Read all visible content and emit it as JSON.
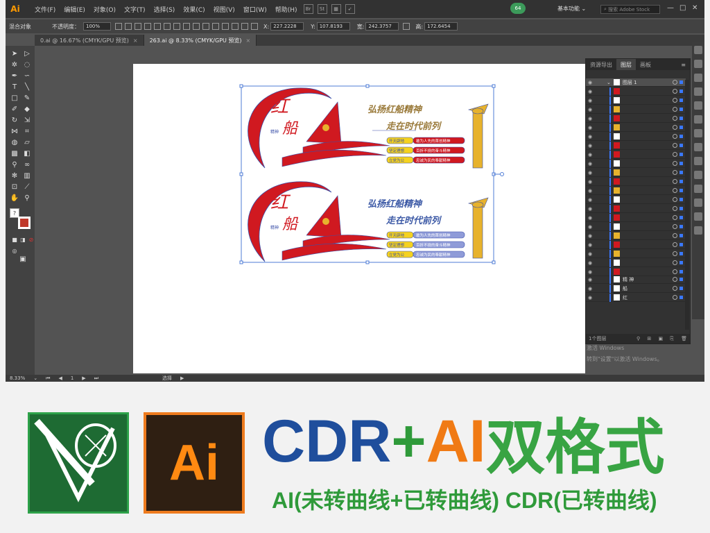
{
  "app": {
    "logo": "Ai",
    "menu": [
      "文件(F)",
      "编辑(E)",
      "对象(O)",
      "文字(T)",
      "选择(S)",
      "效果(C)",
      "视图(V)",
      "窗口(W)",
      "帮助(H)"
    ],
    "bridge_label": "Br",
    "stock_label": "St",
    "update_count": "64",
    "workspace": "基本功能",
    "search_placeholder": "搜索 Adobe Stock"
  },
  "controlbar": {
    "selection": "混合对象",
    "opacity_label": "不透明度：",
    "opacity_value": "100%",
    "x_label": "X:",
    "x_value": "227.2228",
    "y_label": "Y:",
    "y_value": "107.8193",
    "w_label": "宽:",
    "w_value": "242.3757",
    "h_label": "高:",
    "h_value": "172.6454"
  },
  "tabs": [
    {
      "label": "0.ai @ 16.67% (CMYK/GPU 预览)",
      "close": "×"
    },
    {
      "label": "263.ai @ 8.33% (CMYK/GPU 预览)",
      "close": "×"
    }
  ],
  "status": {
    "zoom": "8.33%",
    "page": "1",
    "tool": "选择"
  },
  "artwork": {
    "headline_1": "弘扬红船精神",
    "headline_2": "走在时代前列",
    "logo_big": "红",
    "logo_big_2": "船",
    "logo_small": "精神",
    "badges": [
      {
        "left": "开天辟地",
        "right": "敢为人先的首创精神"
      },
      {
        "left": "坚定理想",
        "right": "百折不挠的奋斗精神"
      },
      {
        "left": "立党为公",
        "right": "忠诚为民的奉献精神"
      }
    ]
  },
  "layers_panel": {
    "tabs": [
      "资源导出",
      "图层",
      "画板"
    ],
    "top_layer": "图层 1",
    "named_rows": [
      {
        "name": "精 神"
      },
      {
        "name": "船"
      },
      {
        "name": "红"
      }
    ],
    "footer": "1个图层"
  },
  "watermark": {
    "activate_line1": "激活 Windows",
    "activate_line2": "转到\"设置\"以激活 Windows。"
  },
  "banner": {
    "cdr": "CDR",
    "plus": "+",
    "ai": "AI",
    "dual": "双格式",
    "ai_logo": "Ai",
    "subtitle": "AI(未转曲线+已转曲线) CDR(已转曲线)"
  },
  "colors": {
    "red": "#d01920",
    "gold": "#e7b22d",
    "blue_text": "#3d5aa6",
    "cdr_blue": "#1f4e9c",
    "ai_orange": "#f07a14",
    "green": "#2f9a3a"
  }
}
